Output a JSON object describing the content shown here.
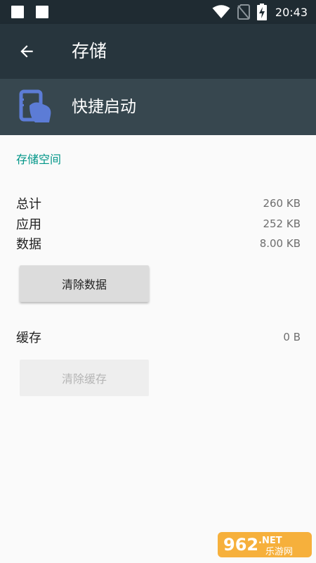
{
  "status_bar": {
    "time": "20:43",
    "icons": [
      "notification-square-icon",
      "notification-square-icon",
      "wifi-icon",
      "no-sim-icon",
      "battery-charging-icon"
    ]
  },
  "toolbar": {
    "title": "存储",
    "back_icon": "arrow-back-icon"
  },
  "app": {
    "name": "快捷启动",
    "icon": "app-phone-hand-icon",
    "icon_color": "#5c7cd6"
  },
  "storage": {
    "section_title": "存储空间",
    "rows": [
      {
        "label": "总计",
        "value": "260 KB"
      },
      {
        "label": "应用",
        "value": "252 KB"
      },
      {
        "label": "数据",
        "value": "8.00 KB"
      }
    ],
    "clear_data_label": "清除数据"
  },
  "cache": {
    "label": "缓存",
    "value": "0 B",
    "clear_cache_label": "清除缓存"
  },
  "watermark": {
    "number": "962",
    "suffix": ".NET",
    "sub": "乐游网"
  },
  "colors": {
    "accent": "#009688",
    "toolbar": "#27353d",
    "header": "#37474f",
    "status_bar": "#1f2b32"
  }
}
